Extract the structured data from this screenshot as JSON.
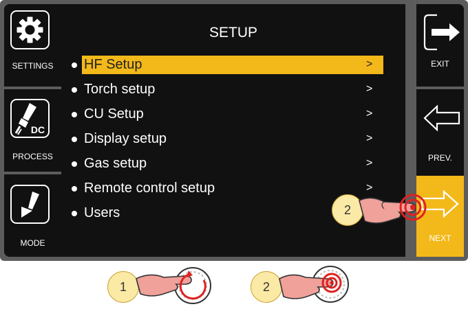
{
  "left_buttons": [
    {
      "label": "SETTINGS",
      "icon": "gear-icon"
    },
    {
      "label": "PROCESS",
      "icon": "tig-torch-dc-icon",
      "icon_text": "DC"
    },
    {
      "label": "MODE",
      "icon": "mode-arrow-icon"
    }
  ],
  "right_buttons": [
    {
      "label": "EXIT",
      "icon": "exit-arrow-icon"
    },
    {
      "label": "PREV.",
      "icon": "left-arrow-icon"
    },
    {
      "label": "NEXT",
      "icon": "right-arrow-icon"
    }
  ],
  "screen": {
    "title": "SETUP",
    "items": [
      {
        "label": "HF Setup",
        "chevron": ">",
        "selected": true
      },
      {
        "label": "Torch setup",
        "chevron": ">"
      },
      {
        "label": "CU Setup",
        "chevron": ">"
      },
      {
        "label": "Display setup",
        "chevron": ">"
      },
      {
        "label": "Gas setup",
        "chevron": ">"
      },
      {
        "label": "Remote control setup",
        "chevron": ">"
      },
      {
        "label": "Users",
        "chevron": ""
      }
    ]
  },
  "callouts": {
    "screen_step": "2",
    "knob_turn_step": "1",
    "knob_press_step": "2"
  },
  "colors": {
    "accent": "#f3b81a",
    "panel": "#111111",
    "frame": "#5c5c5c",
    "badge": "#fbe9a6",
    "hand": "#f0a19a",
    "press": "#e02020"
  }
}
